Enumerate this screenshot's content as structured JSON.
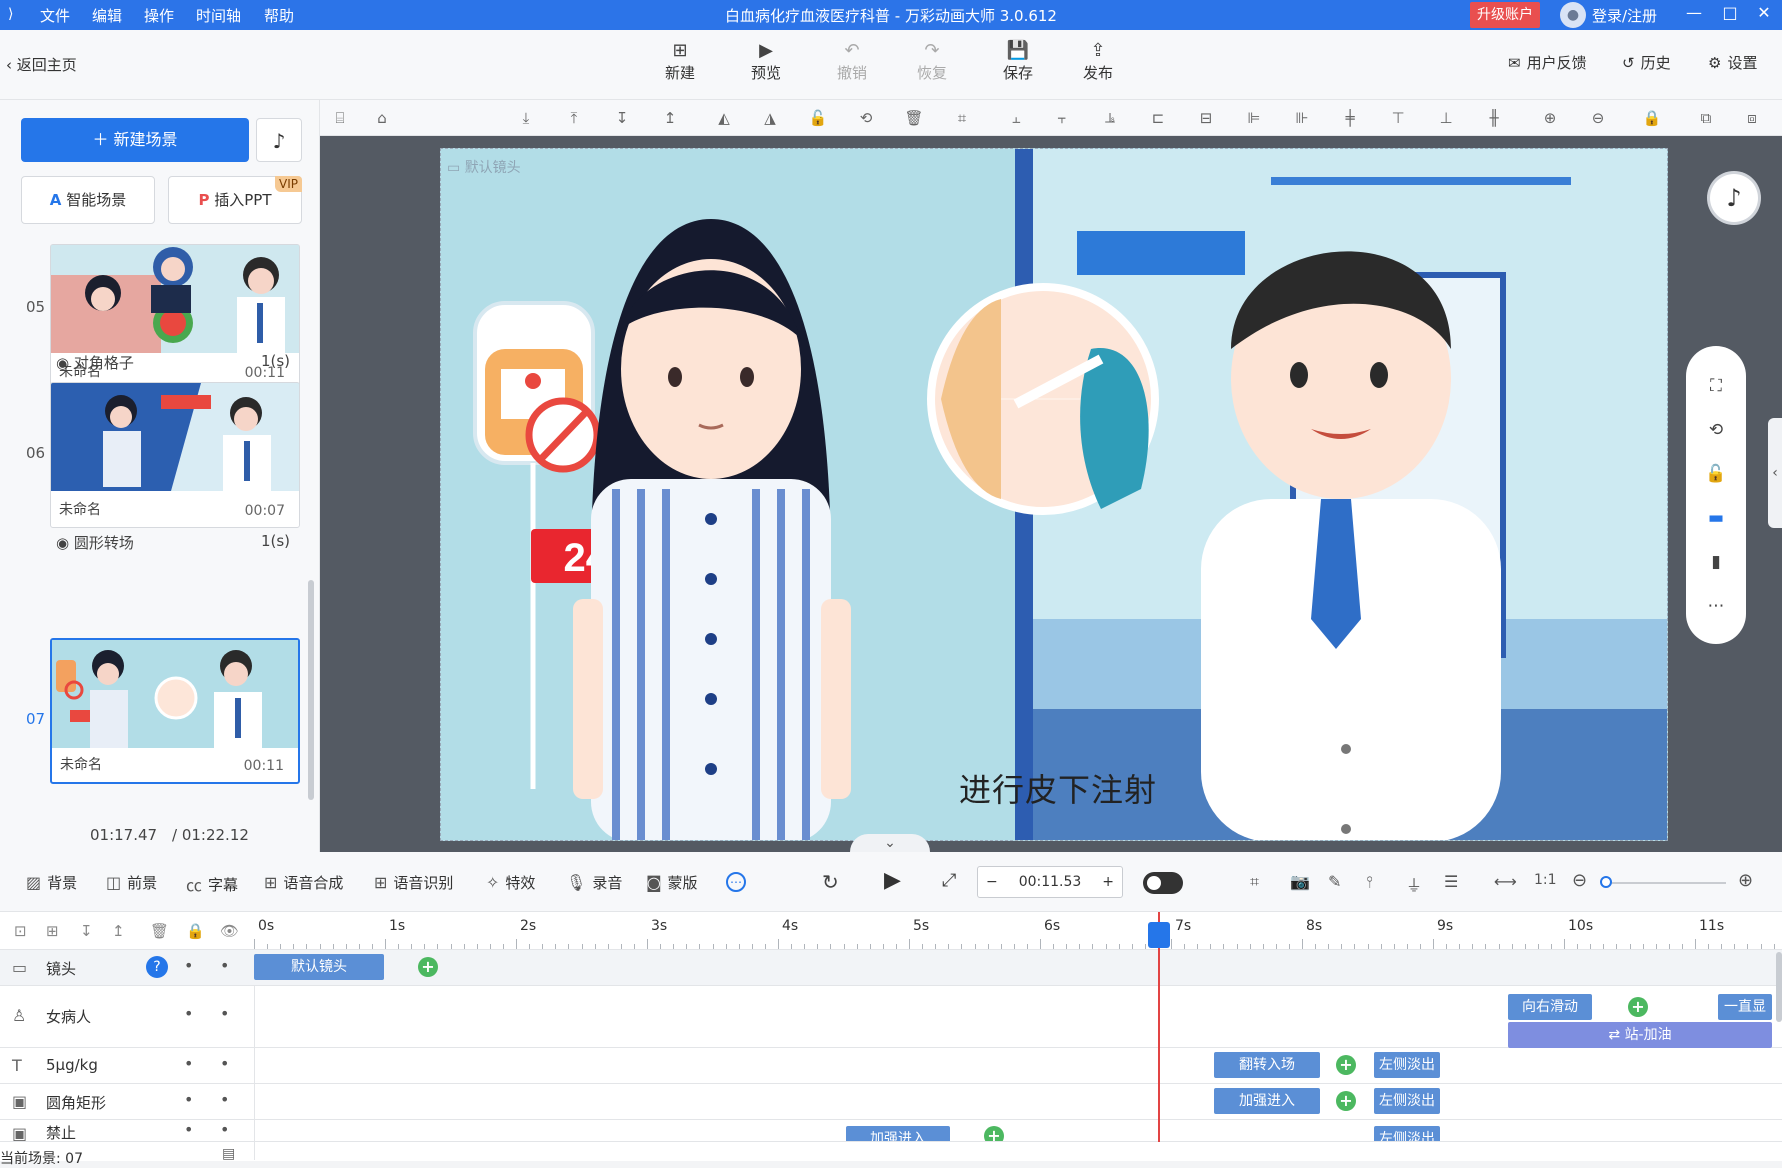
{
  "menubar": {
    "menus": [
      "文件",
      "编辑",
      "操作",
      "时间轴",
      "帮助"
    ],
    "title": "白血病化疗血液医疗科普 - 万彩动画大师 3.0.612",
    "upgrade": "升级账户",
    "login": "登录/注册",
    "brand_color": "#2c74e8"
  },
  "toolbar": {
    "back": "返回主页",
    "new": "新建",
    "preview": "预览",
    "undo": "撤销",
    "redo": "恢复",
    "save": "保存",
    "publish": "发布",
    "feedback": "用户反馈",
    "history": "历史",
    "settings": "设置"
  },
  "left": {
    "new_scene": "新建场景",
    "smart_scene": "智能场景",
    "insert_ppt": "插入PPT",
    "vip": "VIP",
    "scenes": [
      {
        "num": "05",
        "name": "未命名",
        "time": "00:11",
        "transition": "对角格子",
        "trans_time": "1(s)"
      },
      {
        "num": "06",
        "name": "未命名",
        "time": "00:07",
        "transition": "圆形转场",
        "trans_time": "1(s)"
      },
      {
        "num": "07",
        "name": "未命名",
        "time": "00:11"
      }
    ],
    "current_time": "01:17.47",
    "total_time": "/ 01:22.12"
  },
  "stage": {
    "camera_label": "默认镜头",
    "subtitle": "进行皮下注射",
    "badge": "24h"
  },
  "tlbar": {
    "background": "背景",
    "foreground": "前景",
    "caption": "字幕",
    "tts": "语音合成",
    "asr": "语音识别",
    "effects": "特效",
    "record": "录音",
    "mask": "蒙版",
    "time": "00:11.53"
  },
  "timeline": {
    "ticks": [
      "0s",
      "1s",
      "2s",
      "3s",
      "4s",
      "5s",
      "6s",
      "7s",
      "8s",
      "9s",
      "10s",
      "11s"
    ],
    "tracks": [
      {
        "name": "镜头",
        "icon": "camera-icon"
      },
      {
        "name": "女病人",
        "icon": "person-icon"
      },
      {
        "name": "5μg/kg",
        "icon": "text-icon"
      },
      {
        "name": "圆角矩形",
        "icon": "image-icon"
      },
      {
        "name": "禁止",
        "icon": "image-icon"
      }
    ],
    "clips": {
      "camera": "默认镜头",
      "patient_a": "向右滑动",
      "patient_b": "一直显",
      "patient_c": "站-加油",
      "text_a": "翻转入场",
      "text_b": "左侧淡出",
      "rect_a": "加强进入",
      "rect_b": "左侧淡出",
      "ban_a": "加强进入",
      "ban_b": "左侧淡出"
    },
    "status": "当前场景: 07"
  }
}
